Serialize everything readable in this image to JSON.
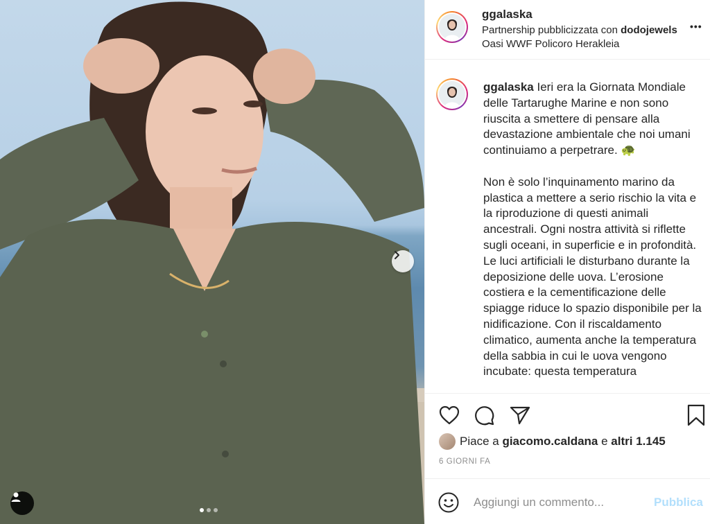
{
  "post": {
    "username": "ggalaska",
    "partnership_prefix": "Partnership pubblicizzata con ",
    "partner": "dodojewels",
    "location": "Oasi WWF Policoro Herakleia",
    "more_icon": "more-dots-icon"
  },
  "caption": {
    "username": "ggalaska",
    "text": " Ieri era la Giornata Mondiale delle Tartarughe Marine e non sono riuscita a smettere di pensare alla devastazione ambientale che noi umani continuiamo a perpetrare. 🐢\n\nNon è solo l’inquinamento marino da plastica a mettere a serio rischio la vita e la riproduzione di questi animali ancestrali. Ogni nostra attività si riflette sugli oceani, in superficie e in profondità. Le luci artificiali le disturbano durante la deposizione delle uova. L’erosione costiera e la cementificazione delle spiagge riduce lo spazio disponibile per la nidificazione. Con il riscaldamento climatico, aumenta anche la temperatura della sabbia in cui le uova vengono incubate: questa temperatura"
  },
  "likes": {
    "prefix": "Piace a ",
    "user": "giacomo.caldana",
    "middle": " e ",
    "others": "altri 1.145"
  },
  "timestamp": "6 GIORNI FA",
  "comment": {
    "placeholder": "Aggiungi un commento...",
    "publish_label": "Pubblica"
  },
  "carousel": {
    "total": 3,
    "current": 1
  },
  "colors": {
    "text": "#262626",
    "secondary": "#8e8e8e",
    "publish_disabled": "#b2dffc",
    "divider": "#efefef"
  }
}
